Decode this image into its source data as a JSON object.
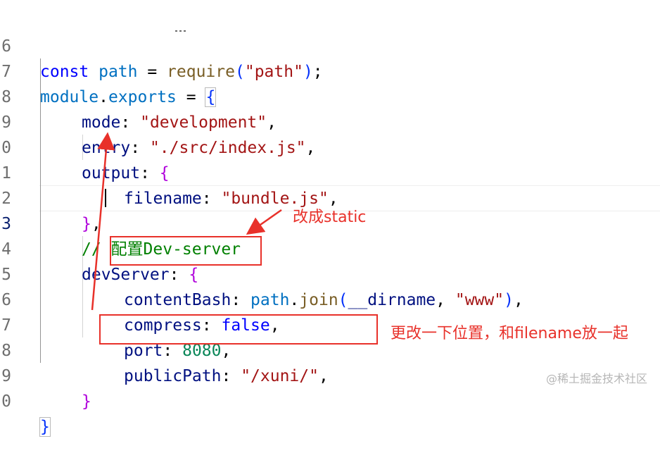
{
  "line_numbers": [
    "6",
    "7",
    "8",
    "9",
    "0",
    "1",
    "2",
    "3",
    "4",
    "5",
    "6",
    "7",
    "8",
    "9",
    "0"
  ],
  "code": {
    "l1": {
      "const": "const",
      "path": "path",
      "eq": " = ",
      "require": "require",
      "lp": "(",
      "str": "\"path\"",
      "rp": ")",
      "semi": ";"
    },
    "l2": {
      "module": "module",
      "dot": ".",
      "exports": "exports",
      "eq": " = ",
      "brace": "{"
    },
    "l3": {
      "key": "mode",
      "colon": ": ",
      "str": "\"development\"",
      "comma": ","
    },
    "l4": {
      "key": "entry",
      "colon": ": ",
      "str": "\"./src/index.js\"",
      "comma": ","
    },
    "l5": {
      "key": "output",
      "colon": ": ",
      "brace": "{"
    },
    "l6": {
      "key": "filename",
      "colon": ": ",
      "str": "\"bundle.js\"",
      "comma": ","
    },
    "l7": {
      "brace": "}",
      "comma": ","
    },
    "l8": {
      "comment": "// 配置Dev-server"
    },
    "l9": {
      "key": "devServer",
      "colon": ": ",
      "brace": "{"
    },
    "l10": {
      "key": "contentBash",
      "colon": ": ",
      "path": "path",
      "dot": ".",
      "fn": "join",
      "lp": "(",
      "arg": "__dirname",
      "sep": ", ",
      "str": "\"www\"",
      "rp": ")",
      "comma": ","
    },
    "l11": {
      "key": "compress",
      "colon": ": ",
      "val": "false",
      "comma": ","
    },
    "l12": {
      "key": "port",
      "colon": ": ",
      "num": "8080",
      "comma": ","
    },
    "l13": {
      "key": "publicPath",
      "colon": ": ",
      "str": "\"/xuni/\"",
      "comma": ","
    },
    "l14": {
      "brace": "}"
    },
    "l15": {
      "brace": "}"
    }
  },
  "annotations": {
    "note1": "改成static",
    "note2": "更改一下位置，和filename放一起",
    "color": "#e8312a"
  },
  "watermark": "@稀土掘金技术社区"
}
